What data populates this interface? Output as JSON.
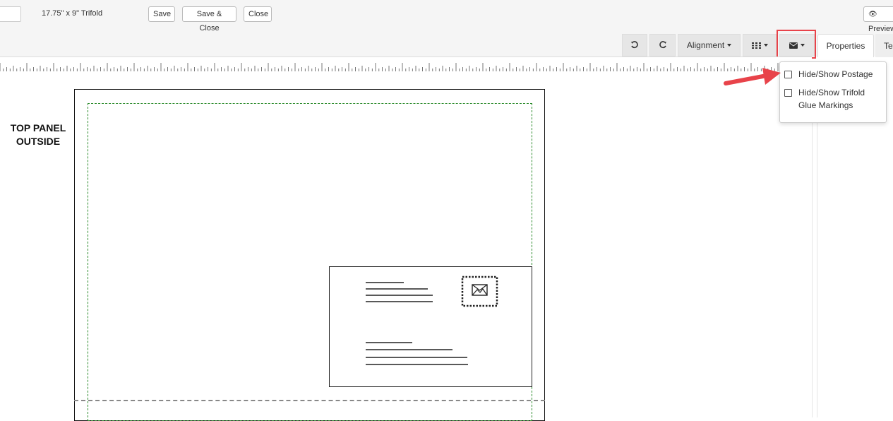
{
  "header": {
    "size_label": "17.75\" x 9\" Trifold",
    "save_label": "Save",
    "save_close_label": "Save & Close",
    "close_label": "Close",
    "preview_label": "Preview"
  },
  "toolbar": {
    "undo_icon": "undo-icon",
    "redo_icon": "redo-icon",
    "alignment_label": "Alignment",
    "grid_icon": "grid-icon",
    "mail_icon": "envelope-icon"
  },
  "tabs": [
    {
      "label": "Properties",
      "active": true
    },
    {
      "label": "Text",
      "active": false
    }
  ],
  "mail_menu": {
    "items": [
      {
        "label": "Hide/Show Postage",
        "checked": false
      },
      {
        "label": "Hide/Show Trifold Glue Markings",
        "checked": false
      }
    ]
  },
  "canvas": {
    "panel_label_line1": "TOP PANEL",
    "panel_label_line2": "OUTSIDE",
    "postage_icon": "stamp-icon"
  },
  "colors": {
    "highlight": "#e8434a",
    "safe_zone": "#2a8a2a",
    "toolbar_button": "#e6e6e6"
  }
}
